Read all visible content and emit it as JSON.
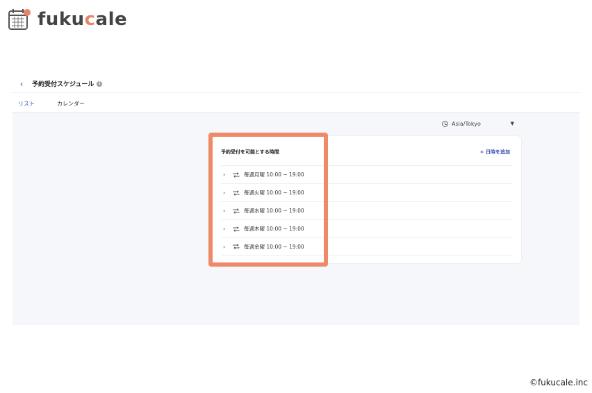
{
  "brand": {
    "logo_prefix": "fuku",
    "logo_accent": "c",
    "logo_suffix": "ale",
    "accent_color": "#e8846a",
    "copyright": "©fukucale.inc"
  },
  "header": {
    "title": "予約受付スケジュール"
  },
  "tabs": [
    {
      "label": "リスト",
      "active": true
    },
    {
      "label": "カレンダー",
      "active": false
    }
  ],
  "timezone": {
    "value": "Asia/Tokyo"
  },
  "card": {
    "title": "予約受付を可能とする時間",
    "add_label": "+ 日時を追加",
    "rows": [
      {
        "label": "毎週月曜 10:00 ~ 19:00"
      },
      {
        "label": "毎週火曜 10:00 ~ 19:00"
      },
      {
        "label": "毎週水曜 10:00 ~ 19:00"
      },
      {
        "label": "毎週木曜 10:00 ~ 19:00"
      },
      {
        "label": "毎週金曜 10:00 ~ 19:00"
      }
    ]
  },
  "highlight_color": "#ee8a68"
}
